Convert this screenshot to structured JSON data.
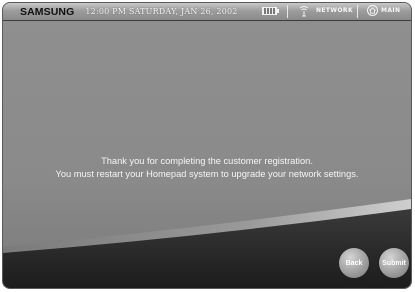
{
  "header": {
    "brand": "SAMSUNG",
    "datetime": "12:00 PM SATURDAY, JAN 26, 2002",
    "network_label": "NETWORK",
    "main_label": "MAIN"
  },
  "message": {
    "line1": "Thank you for completing the customer registration.",
    "line2": "You must restart your Homepad system to upgrade your network settings."
  },
  "buttons": {
    "back_label": "Back",
    "submit_label": "Submit"
  },
  "colors": {
    "panel": "#8e8e8e",
    "footer_dark": "#262626",
    "text": "#f5f5f5"
  },
  "icons": [
    "battery-icon",
    "network-icon",
    "home-icon"
  ]
}
